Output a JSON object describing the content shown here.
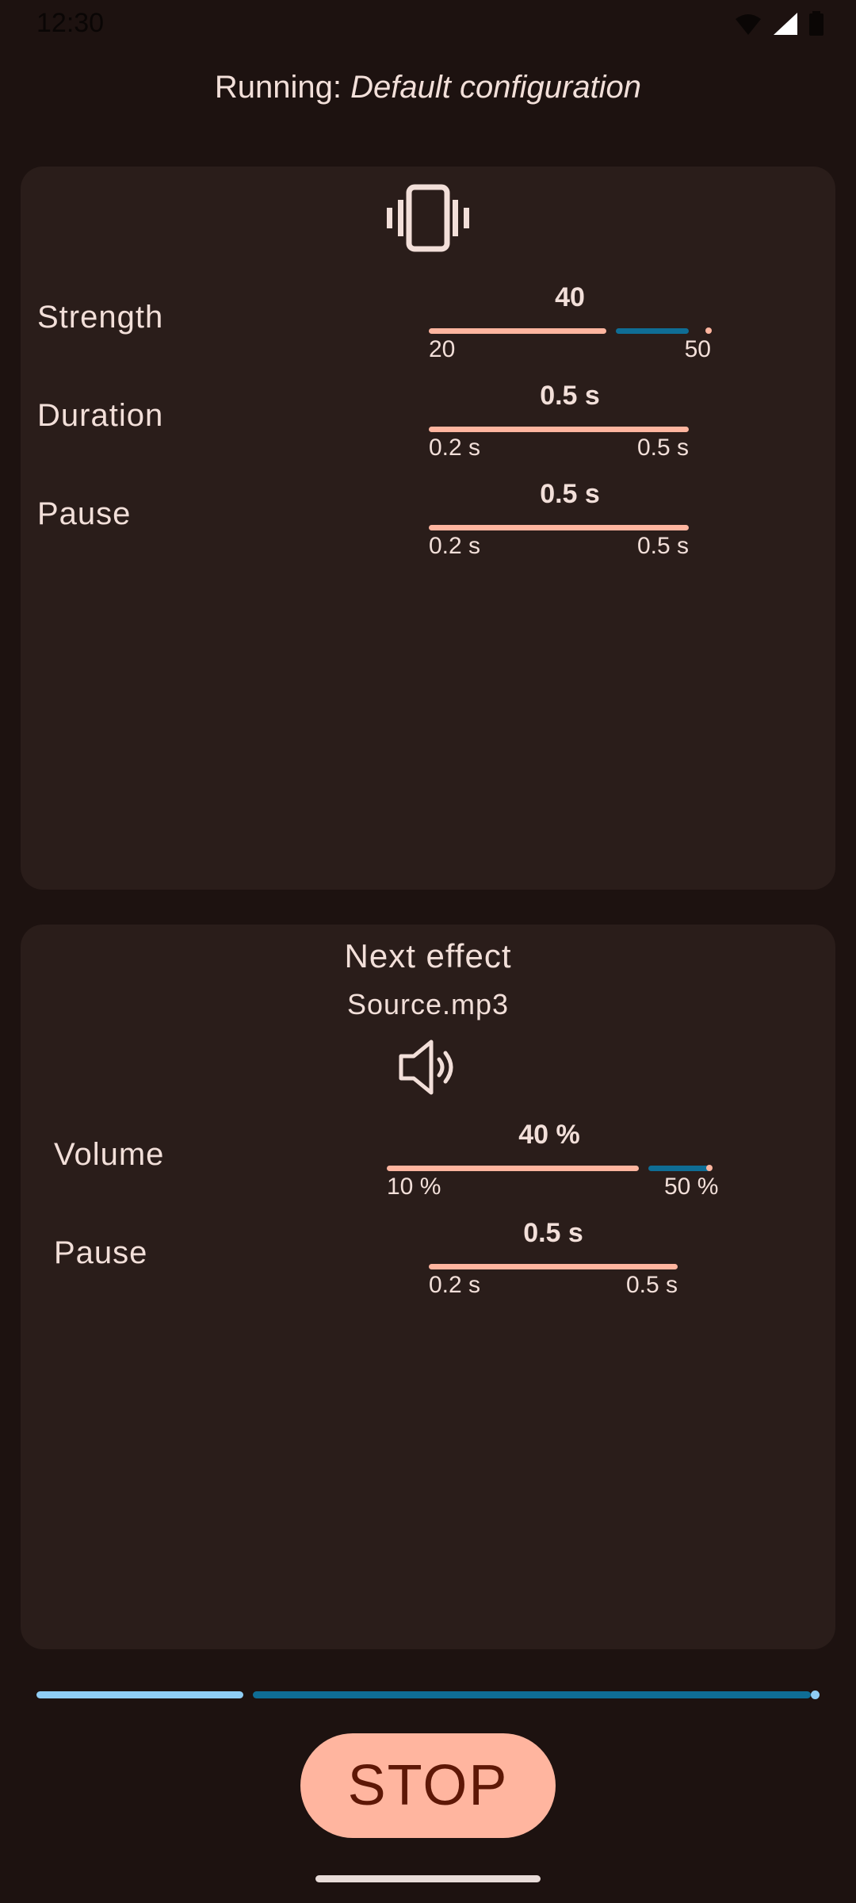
{
  "status_bar": {
    "time": "12:30",
    "icons": [
      "wifi-icon",
      "signal-icon",
      "battery-icon"
    ]
  },
  "header": {
    "prefix": "Running: ",
    "config_name": "Default configuration"
  },
  "vibration_card": {
    "icon": "vibration-icon",
    "rows": [
      {
        "label": "Strength",
        "value": "40",
        "min": "20",
        "max": "50",
        "fraction": 0.67
      },
      {
        "label": "Duration",
        "value": "0.5 s",
        "min": "0.2 s",
        "max": "0.5 s",
        "fraction": 1.0
      },
      {
        "label": "Pause",
        "value": "0.5 s",
        "min": "0.2 s",
        "max": "0.5 s",
        "fraction": 1.0
      }
    ]
  },
  "sound_card": {
    "title": "Next effect",
    "source": "Source.mp3",
    "icon": "speaker-icon",
    "rows": [
      {
        "label": "Volume",
        "value": "40 %",
        "min": "10 %",
        "max": "50 %",
        "fraction": 0.75
      },
      {
        "label": "Pause",
        "value": "0.5 s",
        "min": "0.2 s",
        "max": "0.5 s",
        "fraction": 1.0
      }
    ]
  },
  "progress": {
    "fraction": 0.27
  },
  "stop_button": {
    "label": "STOP"
  },
  "colors": {
    "background": "#1d1210",
    "card": "#2a1d1a",
    "accent": "#ffb59f",
    "inactive_track": "#0f6d95",
    "progress_done": "#8fcdf4",
    "text": "#f2dfd9"
  }
}
